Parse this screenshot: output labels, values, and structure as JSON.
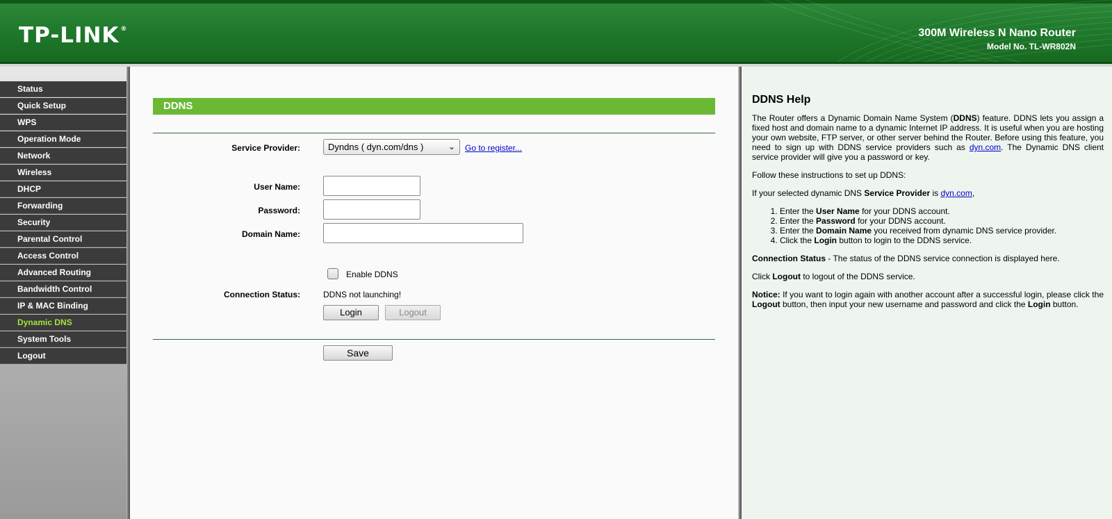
{
  "header": {
    "logo": "TP-LINK",
    "logo_reg": "®",
    "product": "300M Wireless N Nano Router",
    "model": "Model No. TL-WR802N"
  },
  "sidebar": {
    "items": [
      {
        "label": "Status"
      },
      {
        "label": "Quick Setup"
      },
      {
        "label": "WPS"
      },
      {
        "label": "Operation Mode"
      },
      {
        "label": "Network"
      },
      {
        "label": "Wireless"
      },
      {
        "label": "DHCP"
      },
      {
        "label": "Forwarding"
      },
      {
        "label": "Security"
      },
      {
        "label": "Parental Control"
      },
      {
        "label": "Access Control"
      },
      {
        "label": "Advanced Routing"
      },
      {
        "label": "Bandwidth Control"
      },
      {
        "label": "IP & MAC Binding"
      },
      {
        "label": "Dynamic DNS",
        "active": true
      },
      {
        "label": "System Tools"
      },
      {
        "label": "Logout"
      }
    ],
    "active_color": "#a8e23a"
  },
  "main": {
    "title": "DDNS",
    "service_provider_label": "Service Provider:",
    "service_provider_value": "Dyndns ( dyn.com/dns )",
    "register_link": "Go to register...",
    "username_label": "User Name:",
    "username_value": "",
    "password_label": "Password:",
    "password_value": "",
    "domain_label": "Domain Name:",
    "domain_value": "",
    "enable_label": "Enable DDNS",
    "enable_checked": false,
    "status_label": "Connection Status:",
    "status_value": "DDNS not launching!",
    "login_button": "Login",
    "logout_button": "Logout",
    "save_button": "Save"
  },
  "help": {
    "title": "DDNS Help",
    "p1_a": "The Router offers a Dynamic Domain Name System (",
    "p1_b": "DDNS",
    "p1_c": ") feature. DDNS lets you assign a fixed host and domain name to a dynamic Internet IP address. It is useful when you are hosting your own website, FTP server, or other server behind the Router. Before using this feature, you need to sign up with DDNS service providers such as ",
    "p1_link": "dyn.com",
    "p1_d": ". The Dynamic DNS client service provider will give you a password or key.",
    "p2": "Follow these instructions to set up DDNS:",
    "p3_a": "If your selected dynamic DNS ",
    "p3_b": "Service Provider",
    "p3_c": " is ",
    "p3_link": "dyn.com",
    "p3_d": ",",
    "steps": [
      {
        "a": "Enter the ",
        "b": "User Name",
        "c": " for your DDNS account."
      },
      {
        "a": "Enter the ",
        "b": "Password",
        "c": " for your DDNS account."
      },
      {
        "a": "Enter the ",
        "b": "Domain Name",
        "c": " you received from dynamic DNS service provider."
      },
      {
        "a": "Click the ",
        "b": "Login",
        "c": " button to login to the DDNS service."
      }
    ],
    "p4_a": "Connection Status",
    "p4_b": " - The status of the DDNS service connection is displayed here.",
    "p5_a": "Click ",
    "p5_b": "Logout",
    "p5_c": " to logout of the DDNS service.",
    "p6_a": "Notice:",
    "p6_b": "  If you want to login again with another account after a successful login, please click the ",
    "p6_c": "Logout",
    "p6_d": " button, then input your new username and password and click the ",
    "p6_e": "Login",
    "p6_f": " button."
  }
}
